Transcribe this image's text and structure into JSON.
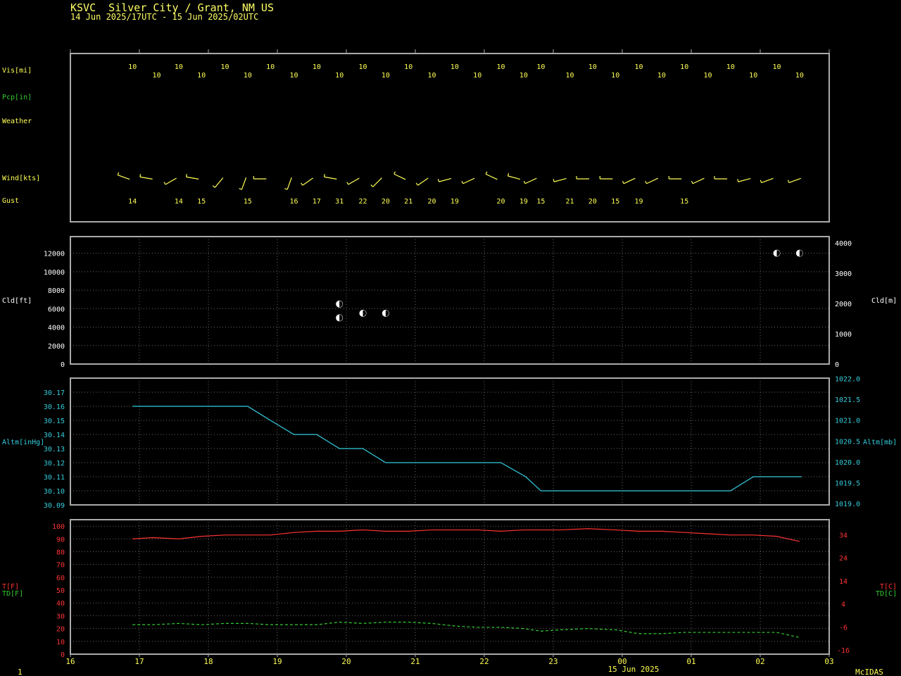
{
  "header": {
    "title": "KSVC  Silver City / Grant, NM US",
    "period": "14 Jun 2025/17UTC - 15 Jun 2025/02UTC"
  },
  "footer": {
    "left": "1",
    "date": "15 Jun 2025",
    "brand": "McIDAS"
  },
  "colors": {
    "yellow": "#ffff55",
    "white": "#ffffff",
    "cyan": "#33ccdd",
    "red": "#ff3333",
    "green": "#33cc33",
    "frame": "#aaaaaa",
    "grid": "#666666"
  },
  "chart_data": [
    {
      "id": "surface-obs",
      "type": "table",
      "labels": {
        "vis": "Vis[mi]",
        "pcp": "Pcp[in]",
        "weather": "Weather",
        "wind": "Wind[kts]",
        "gust": "Gust"
      },
      "x_ticks": [
        "16",
        "17",
        "18",
        "19",
        "20",
        "21",
        "22",
        "23",
        "00",
        "01",
        "02",
        "03"
      ],
      "x_range": [
        16,
        27
      ],
      "vis": [
        {
          "t": 16.9,
          "v": "10"
        },
        {
          "t": 17.25,
          "v": "10"
        },
        {
          "t": 17.57,
          "v": "10"
        },
        {
          "t": 17.9,
          "v": "10"
        },
        {
          "t": 18.24,
          "v": "10"
        },
        {
          "t": 18.57,
          "v": "10"
        },
        {
          "t": 18.9,
          "v": "10"
        },
        {
          "t": 19.24,
          "v": "10"
        },
        {
          "t": 19.57,
          "v": "10"
        },
        {
          "t": 19.9,
          "v": "10"
        },
        {
          "t": 20.24,
          "v": "10"
        },
        {
          "t": 20.57,
          "v": "10"
        },
        {
          "t": 20.9,
          "v": "10"
        },
        {
          "t": 21.24,
          "v": "10"
        },
        {
          "t": 21.57,
          "v": "10"
        },
        {
          "t": 21.9,
          "v": "10"
        },
        {
          "t": 22.24,
          "v": "10"
        },
        {
          "t": 22.57,
          "v": "10"
        },
        {
          "t": 22.82,
          "v": "10"
        },
        {
          "t": 23.24,
          "v": "10"
        },
        {
          "t": 23.57,
          "v": "10"
        },
        {
          "t": 23.9,
          "v": "10"
        },
        {
          "t": 24.24,
          "v": "10"
        },
        {
          "t": 24.57,
          "v": "10"
        },
        {
          "t": 24.9,
          "v": "10"
        },
        {
          "t": 25.24,
          "v": "10"
        },
        {
          "t": 25.57,
          "v": "10"
        },
        {
          "t": 25.9,
          "v": "10"
        },
        {
          "t": 26.24,
          "v": "10"
        },
        {
          "t": 26.57,
          "v": "10"
        }
      ],
      "wind": [
        {
          "t": 16.84,
          "dir": 290
        },
        {
          "t": 17.17,
          "dir": 280
        },
        {
          "t": 17.52,
          "dir": 240
        },
        {
          "t": 17.84,
          "dir": 280
        },
        {
          "t": 18.2,
          "dir": 220
        },
        {
          "t": 18.54,
          "dir": 200
        },
        {
          "t": 18.82,
          "dir": 270
        },
        {
          "t": 19.2,
          "dir": 200
        },
        {
          "t": 19.5,
          "dir": 235
        },
        {
          "t": 19.84,
          "dir": 280
        },
        {
          "t": 20.17,
          "dir": 240
        },
        {
          "t": 20.5,
          "dir": 225
        },
        {
          "t": 20.84,
          "dir": 295
        },
        {
          "t": 21.17,
          "dir": 235
        },
        {
          "t": 21.5,
          "dir": 255
        },
        {
          "t": 21.84,
          "dir": 245
        },
        {
          "t": 22.17,
          "dir": 295
        },
        {
          "t": 22.5,
          "dir": 285
        },
        {
          "t": 22.74,
          "dir": 245
        },
        {
          "t": 23.17,
          "dir": 255
        },
        {
          "t": 23.5,
          "dir": 270
        },
        {
          "t": 23.84,
          "dir": 270
        },
        {
          "t": 24.17,
          "dir": 245
        },
        {
          "t": 24.5,
          "dir": 245
        },
        {
          "t": 24.84,
          "dir": 270
        },
        {
          "t": 25.17,
          "dir": 245
        },
        {
          "t": 25.5,
          "dir": 270
        },
        {
          "t": 25.84,
          "dir": 255
        },
        {
          "t": 26.17,
          "dir": 250
        },
        {
          "t": 26.57,
          "dir": 250
        }
      ],
      "gust": [
        {
          "t": 16.9,
          "v": "14"
        },
        {
          "t": 17.57,
          "v": "14"
        },
        {
          "t": 17.9,
          "v": "15"
        },
        {
          "t": 18.57,
          "v": "15"
        },
        {
          "t": 19.24,
          "v": "16"
        },
        {
          "t": 19.57,
          "v": "17"
        },
        {
          "t": 19.9,
          "v": "31"
        },
        {
          "t": 20.24,
          "v": "22"
        },
        {
          "t": 20.57,
          "v": "20"
        },
        {
          "t": 20.9,
          "v": "21"
        },
        {
          "t": 21.24,
          "v": "20"
        },
        {
          "t": 21.57,
          "v": "19"
        },
        {
          "t": 22.24,
          "v": "20"
        },
        {
          "t": 22.57,
          "v": "19"
        },
        {
          "t": 22.82,
          "v": "15"
        },
        {
          "t": 23.24,
          "v": "21"
        },
        {
          "t": 23.57,
          "v": "20"
        },
        {
          "t": 23.9,
          "v": "15"
        },
        {
          "t": 24.24,
          "v": "19"
        },
        {
          "t": 24.9,
          "v": "15"
        }
      ]
    },
    {
      "id": "clouds",
      "type": "scatter",
      "ylabel_left": "Cld[ft]",
      "ylabel_right": "Cld[m]",
      "ylim": [
        0,
        13800
      ],
      "left_ticks": [
        0,
        2000,
        4000,
        6000,
        8000,
        10000,
        12000
      ],
      "right_ticks": [
        0,
        1000,
        2000,
        3000,
        4000
      ],
      "points": [
        {
          "x": 19.9,
          "y": 6500
        },
        {
          "x": 19.9,
          "y": 5000
        },
        {
          "x": 20.24,
          "y": 5500
        },
        {
          "x": 20.57,
          "y": 5500
        },
        {
          "x": 26.24,
          "y": 12000
        },
        {
          "x": 26.57,
          "y": 12000
        }
      ]
    },
    {
      "id": "altimeter",
      "type": "line",
      "ylabel_left": "Altm[inHg]",
      "ylabel_right": "Altm[mb]",
      "ylim": [
        30.09,
        30.18
      ],
      "left_ticks": [
        "30.09",
        "30.10",
        "30.11",
        "30.12",
        "30.13",
        "30.14",
        "30.15",
        "30.16",
        "30.17"
      ],
      "right_ticks": [
        "1019.0",
        "1019.5",
        "1020.0",
        "1020.5",
        "1021.0",
        "1021.5",
        "1022.0"
      ],
      "x": [
        16.9,
        17.5,
        18.0,
        18.57,
        18.9,
        19.24,
        19.57,
        19.9,
        20.24,
        20.57,
        21.0,
        21.5,
        22.0,
        22.24,
        22.6,
        22.82,
        23.5,
        24.0,
        24.5,
        25.0,
        25.57,
        25.9,
        26.24,
        26.6
      ],
      "y": [
        30.16,
        30.16,
        30.16,
        30.16,
        30.15,
        30.14,
        30.14,
        30.13,
        30.13,
        30.12,
        30.12,
        30.12,
        30.12,
        30.12,
        30.11,
        30.1,
        30.1,
        30.1,
        30.1,
        30.1,
        30.1,
        30.11,
        30.11,
        30.11
      ]
    },
    {
      "id": "temperature",
      "type": "line",
      "ylabel_left_1": "T[F]",
      "ylabel_left_2": "TD[F]",
      "ylabel_right_1": "T[C]",
      "ylabel_right_2": "TD[C]",
      "ylim": [
        0,
        105
      ],
      "left_ticks": [
        0,
        10,
        20,
        30,
        40,
        50,
        60,
        70,
        80,
        90,
        100
      ],
      "right_ticks": [
        "-16",
        "-6",
        "4",
        "14",
        "24",
        "34"
      ],
      "x_ticks": [
        "16",
        "17",
        "18",
        "19",
        "20",
        "21",
        "22",
        "23",
        "00",
        "01",
        "02",
        "03"
      ],
      "x": [
        16.9,
        17.2,
        17.57,
        17.9,
        18.24,
        18.57,
        18.9,
        19.24,
        19.57,
        19.9,
        20.24,
        20.57,
        20.9,
        21.24,
        21.57,
        21.9,
        22.24,
        22.57,
        22.82,
        23.1,
        23.5,
        23.9,
        24.24,
        24.57,
        24.9,
        25.24,
        25.57,
        25.9,
        26.24,
        26.57
      ],
      "series": [
        {
          "name": "T[F]",
          "values": [
            90,
            91,
            90,
            92,
            93,
            93,
            93,
            95,
            96,
            96,
            97,
            96,
            96,
            97,
            97,
            97,
            96,
            97,
            97,
            97,
            98,
            97,
            96,
            96,
            95,
            94,
            93,
            93,
            92,
            88
          ]
        },
        {
          "name": "TD[F]",
          "values": [
            23,
            23,
            24,
            23,
            24,
            24,
            23,
            23,
            23,
            25,
            24,
            25,
            25,
            24,
            22,
            21,
            21,
            20,
            18,
            19,
            20,
            19,
            16,
            16,
            17,
            17,
            17,
            17,
            17,
            13
          ]
        }
      ]
    }
  ]
}
